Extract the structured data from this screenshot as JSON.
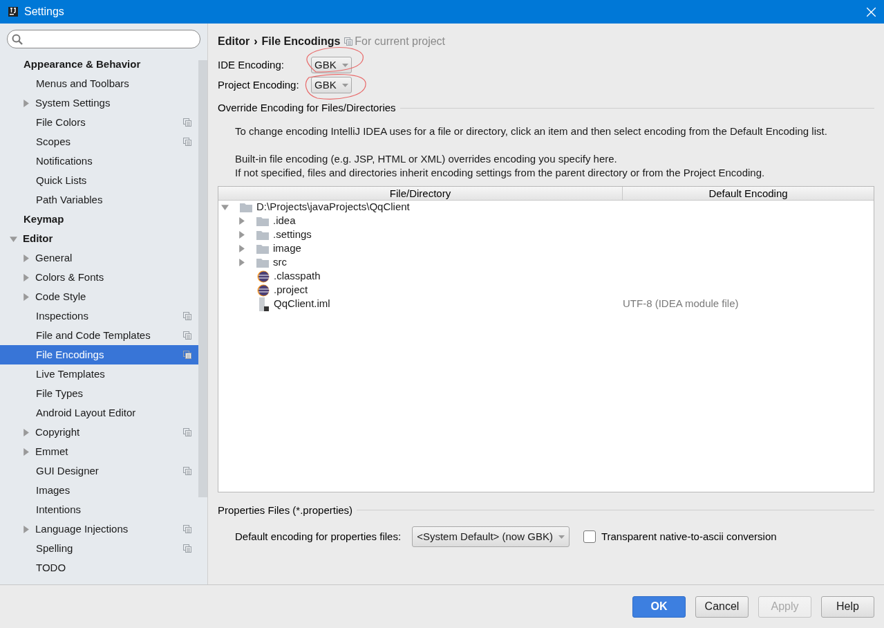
{
  "window": {
    "title": "Settings"
  },
  "sidebar": {
    "sections": [
      {
        "label": "Appearance & Behavior",
        "children": [
          {
            "label": "Menus and Toolbars",
            "selected": false,
            "project": false
          },
          {
            "label": "System Settings",
            "selected": false,
            "project": false,
            "expanded": false
          },
          {
            "label": "File Colors",
            "selected": false,
            "project": true
          },
          {
            "label": "Scopes",
            "selected": false,
            "project": true
          },
          {
            "label": "Notifications",
            "selected": false,
            "project": false
          },
          {
            "label": "Quick Lists",
            "selected": false,
            "project": false
          },
          {
            "label": "Path Variables",
            "selected": false,
            "project": false
          }
        ]
      },
      {
        "label": "Keymap"
      },
      {
        "label": "Editor",
        "expanded": true,
        "children": [
          {
            "label": "General",
            "selected": false,
            "project": false,
            "expanded": false
          },
          {
            "label": "Colors & Fonts",
            "selected": false,
            "project": false,
            "expanded": false
          },
          {
            "label": "Code Style",
            "selected": false,
            "project": false,
            "expanded": false
          },
          {
            "label": "Inspections",
            "selected": false,
            "project": true
          },
          {
            "label": "File and Code Templates",
            "selected": false,
            "project": true
          },
          {
            "label": "File Encodings",
            "selected": true,
            "project": true
          },
          {
            "label": "Live Templates",
            "selected": false,
            "project": false
          },
          {
            "label": "File Types",
            "selected": false,
            "project": false
          },
          {
            "label": "Android Layout Editor",
            "selected": false,
            "project": false
          },
          {
            "label": "Copyright",
            "selected": false,
            "project": true,
            "expanded": false
          },
          {
            "label": "Emmet",
            "selected": false,
            "project": false,
            "expanded": false
          },
          {
            "label": "GUI Designer",
            "selected": false,
            "project": true
          },
          {
            "label": "Images",
            "selected": false,
            "project": false
          },
          {
            "label": "Intentions",
            "selected": false,
            "project": false
          },
          {
            "label": "Language Injections",
            "selected": false,
            "project": true,
            "expanded": false
          },
          {
            "label": "Spelling",
            "selected": false,
            "project": true
          },
          {
            "label": "TODO",
            "selected": false,
            "project": false
          }
        ]
      }
    ]
  },
  "breadcrumb": {
    "parent": "Editor",
    "separator": "›",
    "current": "File Encodings",
    "scope": "For current project"
  },
  "ide_encoding": {
    "label": "IDE Encoding:",
    "value": "GBK"
  },
  "project_encoding": {
    "label": "Project Encoding:",
    "value": "GBK"
  },
  "override": {
    "title": "Override Encoding for Files/Directories",
    "paragraphs": [
      "To change encoding IntelliJ IDEA uses for a file or directory, click an item and then select encoding from the Default Encoding list.",
      "Built-in file encoding (e.g. JSP, HTML or XML) overrides encoding you specify here.\nIf not specified, files and directories inherit encoding settings from the parent directory or from the Project Encoding."
    ],
    "table": {
      "columns": [
        "File/Directory",
        "Default Encoding"
      ],
      "rows": [
        {
          "name": "D:\\Projects\\javaProjects\\QqClient",
          "kind": "folder",
          "expanded": true,
          "children": [
            {
              "name": ".idea",
              "kind": "folder",
              "expanded": false
            },
            {
              "name": ".settings",
              "kind": "folder",
              "expanded": false
            },
            {
              "name": "image",
              "kind": "folder",
              "expanded": false
            },
            {
              "name": "src",
              "kind": "folder",
              "expanded": false
            },
            {
              "name": ".classpath",
              "kind": "eclipse"
            },
            {
              "name": ".project",
              "kind": "eclipse"
            },
            {
              "name": "QqClient.iml",
              "kind": "module",
              "encoding": "UTF-8 (IDEA module file)"
            }
          ]
        }
      ]
    }
  },
  "properties": {
    "title": "Properties Files (*.properties)",
    "label": "Default encoding for properties files:",
    "value": "<System Default> (now GBK)",
    "checkbox": {
      "label": "Transparent native-to-ascii conversion",
      "checked": false
    }
  },
  "buttons": [
    {
      "label": "OK",
      "kind": "primary",
      "disabled": false
    },
    {
      "label": "Cancel",
      "kind": "normal",
      "disabled": false
    },
    {
      "label": "Apply",
      "kind": "normal",
      "disabled": true
    },
    {
      "label": "Help",
      "kind": "normal",
      "disabled": false
    }
  ]
}
